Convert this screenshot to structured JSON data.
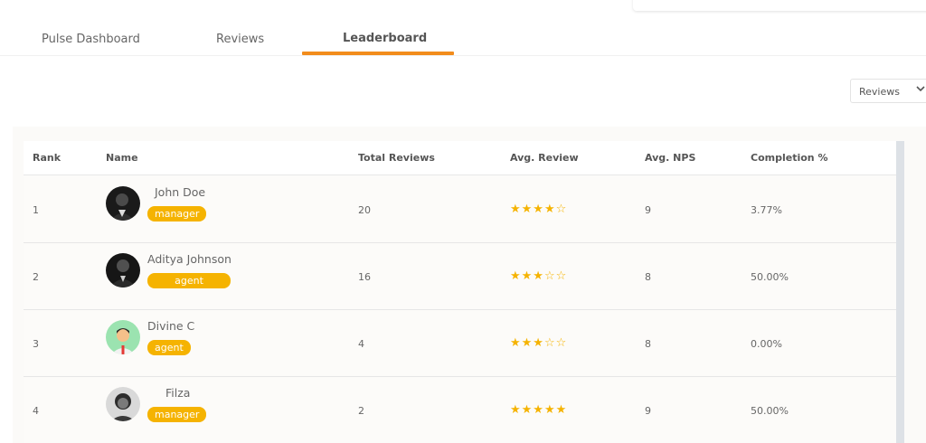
{
  "tabs": [
    {
      "label": "Pulse Dashboard",
      "active": false
    },
    {
      "label": "Reviews",
      "active": false
    },
    {
      "label": "Leaderboard",
      "active": true
    }
  ],
  "filter": {
    "selected": "Reviews"
  },
  "table": {
    "headers": [
      "Rank",
      "Name",
      "Total Reviews",
      "Avg. Review",
      "Avg. NPS",
      "Completion %"
    ],
    "rows": [
      {
        "rank": "1",
        "name": "John Doe",
        "role": "manager",
        "total_reviews": "20",
        "avg_review": 4,
        "avg_review_stars": "★★★★☆",
        "avg_nps": "9",
        "completion": "3.77%"
      },
      {
        "rank": "2",
        "name": "Aditya Johnson",
        "role": "agent",
        "total_reviews": "16",
        "avg_review": 3,
        "avg_review_stars": "★★★☆☆",
        "avg_nps": "8",
        "completion": "50.00%"
      },
      {
        "rank": "3",
        "name": "Divine C",
        "role": "agent",
        "total_reviews": "4",
        "avg_review": 3,
        "avg_review_stars": "★★★☆☆",
        "avg_nps": "8",
        "completion": "0.00%"
      },
      {
        "rank": "4",
        "name": "Filza",
        "role": "manager",
        "total_reviews": "2",
        "avg_review": 5,
        "avg_review_stars": "★★★★★",
        "avg_nps": "9",
        "completion": "50.00%"
      }
    ]
  },
  "colors": {
    "accent": "#f28c1c",
    "badge": "#f5b301",
    "star": "#f5b301"
  }
}
